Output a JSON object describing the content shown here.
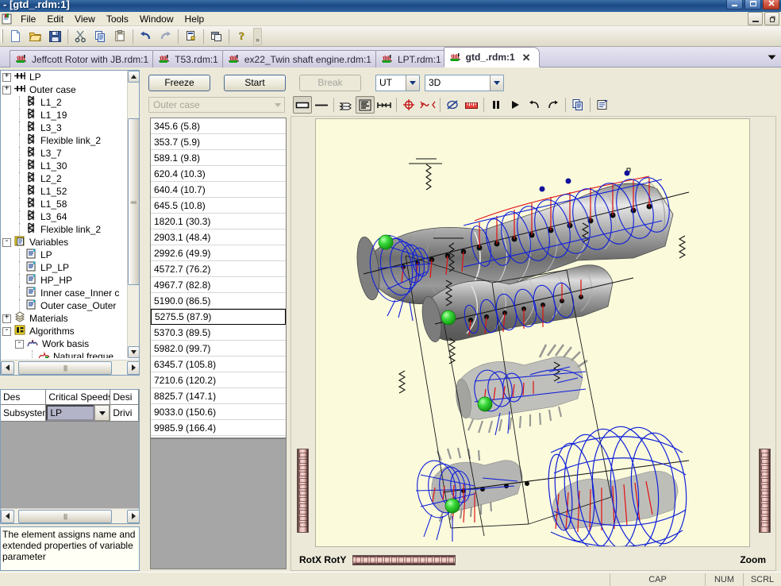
{
  "window": {
    "title": " - [gtd_.rdm:1]",
    "minimize_label": "–",
    "maximize_label": "❐",
    "close_label": "✕",
    "mdi_minimize_label": "–",
    "mdi_restore_label": "❐"
  },
  "menu": {
    "items": [
      {
        "label": "File"
      },
      {
        "label": "Edit"
      },
      {
        "label": "View"
      },
      {
        "label": "Tools"
      },
      {
        "label": "Window"
      },
      {
        "label": "Help"
      }
    ]
  },
  "toolbar": {
    "buttons": [
      {
        "name": "new-document-icon",
        "tip": "New"
      },
      {
        "name": "open-folder-icon",
        "tip": "Open"
      },
      {
        "name": "save-disk-icon",
        "tip": "Save"
      },
      {
        "name": "cut-scissors-icon",
        "tip": "Cut"
      },
      {
        "name": "copy-icon",
        "tip": "Copy"
      },
      {
        "name": "paste-clipboard-icon",
        "tip": "Paste"
      },
      {
        "name": "undo-arrow-icon",
        "tip": "Undo"
      },
      {
        "name": "redo-arrow-icon",
        "tip": "Redo"
      },
      {
        "name": "properties-icon",
        "tip": "Properties"
      },
      {
        "name": "windows-cascade-icon",
        "tip": "Windows"
      },
      {
        "name": "help-question-icon",
        "tip": "Help"
      }
    ],
    "overflow_label": "»"
  },
  "tabs": {
    "items": [
      {
        "label": "Jeffcott Rotor with JB.rdm:1",
        "active": false
      },
      {
        "label": "T53.rdm:1",
        "active": false
      },
      {
        "label": "ex22_Twin shaft engine.rdm:1",
        "active": false
      },
      {
        "label": "LPT.rdm:1",
        "active": false
      },
      {
        "label": "gtd_.rdm:1",
        "active": true
      }
    ],
    "close_label": "✕",
    "dropdown_label": "▼"
  },
  "tree": {
    "items": [
      {
        "label": "LP",
        "indent": 0,
        "expander": "+",
        "icon": "shaft-icon"
      },
      {
        "label": "Outer case",
        "indent": 0,
        "expander": "+",
        "icon": "shaft-icon"
      },
      {
        "label": "L1_2",
        "indent": 1,
        "expander": "",
        "icon": "beam-element-icon"
      },
      {
        "label": "L1_19",
        "indent": 1,
        "expander": "",
        "icon": "beam-element-icon"
      },
      {
        "label": "L3_3",
        "indent": 1,
        "expander": "",
        "icon": "beam-element-icon"
      },
      {
        "label": "Flexible link_2",
        "indent": 1,
        "expander": "",
        "icon": "beam-element-icon"
      },
      {
        "label": "L3_7",
        "indent": 1,
        "expander": "",
        "icon": "beam-element-icon"
      },
      {
        "label": "L1_30",
        "indent": 1,
        "expander": "",
        "icon": "beam-element-icon"
      },
      {
        "label": "L2_2",
        "indent": 1,
        "expander": "",
        "icon": "beam-element-icon"
      },
      {
        "label": "L1_52",
        "indent": 1,
        "expander": "",
        "icon": "beam-element-icon"
      },
      {
        "label": "L1_58",
        "indent": 1,
        "expander": "",
        "icon": "beam-element-icon"
      },
      {
        "label": "L3_64",
        "indent": 1,
        "expander": "",
        "icon": "beam-element-icon"
      },
      {
        "label": "Flexible link_2",
        "indent": 1,
        "expander": "",
        "icon": "beam-element-icon"
      },
      {
        "label": "Variables",
        "indent": 0,
        "expander": "-",
        "icon": "variables-folder-icon"
      },
      {
        "label": "LP",
        "indent": 1,
        "expander": "",
        "icon": "variable-page-icon"
      },
      {
        "label": "LP_LP",
        "indent": 1,
        "expander": "",
        "icon": "variable-page-icon"
      },
      {
        "label": "HP_HP",
        "indent": 1,
        "expander": "",
        "icon": "variable-page-icon"
      },
      {
        "label": "Inner case_Inner c",
        "indent": 1,
        "expander": "",
        "icon": "variable-page-icon"
      },
      {
        "label": "Outer case_Outer",
        "indent": 1,
        "expander": "",
        "icon": "variable-page-icon"
      },
      {
        "label": "Materials",
        "indent": 0,
        "expander": "+",
        "icon": "materials-stack-icon"
      },
      {
        "label": "Algorithms",
        "indent": 0,
        "expander": "-",
        "icon": "algorithms-icon"
      },
      {
        "label": "Work basis",
        "indent": 1,
        "expander": "-",
        "icon": "work-basis-icon"
      },
      {
        "label": "Natural freque",
        "indent": 2,
        "expander": "",
        "icon": "natural-frequency-icon"
      }
    ],
    "scroll_up_label": "▲",
    "scroll_down_label": "▼",
    "scroll_left_label": "◀",
    "scroll_right_label": "▶"
  },
  "properties": {
    "headers": [
      "Des",
      "Critical Speeds",
      "Desi"
    ],
    "row": {
      "name": "Subsystem",
      "value": "LP",
      "third": "Drivi"
    },
    "dropdown_label": "▼"
  },
  "description": {
    "text": "The element assigns name and extended properties of variable parameter"
  },
  "analysis": {
    "freeze_label": "Freeze",
    "start_label": "Start",
    "break_label": "Break",
    "units_value": "UT",
    "view_mode_value": "3D",
    "subsystem_value": "Outer case",
    "dropdown_label": "▼",
    "view_buttons": [
      {
        "name": "solid-view-button",
        "pressed": true
      },
      {
        "name": "line-view-button",
        "pressed": false
      },
      {
        "name": "layered-shapes-button",
        "pressed": false
      },
      {
        "name": "stacked-shapes-button",
        "pressed": true
      },
      {
        "name": "supports-button",
        "pressed": false
      },
      {
        "name": "orbit-marker-button",
        "pressed": false
      },
      {
        "name": "mode-shape-button",
        "pressed": false
      },
      {
        "name": "hide-orbits-button",
        "pressed": false
      },
      {
        "name": "scale-ruler-button",
        "pressed": false
      },
      {
        "name": "pause-button",
        "pressed": false
      },
      {
        "name": "play-button",
        "pressed": false
      },
      {
        "name": "rotate-ccw-button",
        "pressed": false
      },
      {
        "name": "rotate-cw-button",
        "pressed": false
      },
      {
        "name": "copy-view-button",
        "pressed": false
      },
      {
        "name": "view-properties-button",
        "pressed": false
      }
    ]
  },
  "results": {
    "selected_index": 12,
    "items": [
      "345.6 (5.8)",
      "353.7 (5.9)",
      "589.1 (9.8)",
      "620.4 (10.3)",
      "640.4 (10.7)",
      "645.5 (10.8)",
      "1820.1 (30.3)",
      "2903.1 (48.4)",
      "2992.6 (49.9)",
      "4572.7 (76.2)",
      "4967.7 (82.8)",
      "5190.0 (86.5)",
      "5275.5 (87.9)",
      "5370.3 (89.5)",
      "5982.0 (99.7)",
      "6345.7 (105.8)",
      "7210.6 (120.2)",
      "8825.7 (147.1)",
      "9033.0 (150.6)",
      "9985.9 (166.4)"
    ]
  },
  "viewport": {
    "rot_label": "RotX RotY",
    "zoom_label": "Zoom",
    "background_color": "#fbfbdc"
  },
  "statusbar": {
    "left_text": "",
    "cap_text": "CAP",
    "num_text": "NUM",
    "scrl_text": "SCRL"
  }
}
